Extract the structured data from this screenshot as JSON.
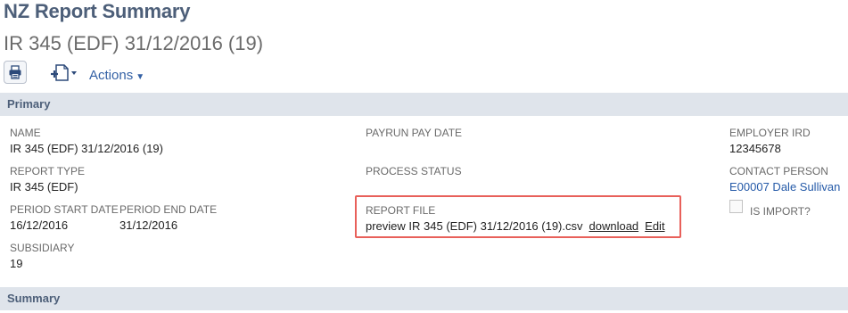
{
  "header": {
    "page_title": "NZ Report Summary",
    "record_title": "IR 345 (EDF) 31/12/2016 (19)"
  },
  "toolbar": {
    "print_icon": "printer-icon",
    "new_icon": "new-document-icon",
    "actions_label": "Actions"
  },
  "sections": {
    "primary": "Primary",
    "summary": "Summary"
  },
  "fields": {
    "name": {
      "label": "NAME",
      "value": "IR 345 (EDF) 31/12/2016 (19)"
    },
    "report_type": {
      "label": "REPORT TYPE",
      "value": "IR 345 (EDF)"
    },
    "period_start": {
      "label": "PERIOD START DATE",
      "value": "16/12/2016"
    },
    "period_end": {
      "label": "PERIOD END DATE",
      "value": "31/12/2016"
    },
    "subsidiary": {
      "label": "SUBSIDIARY",
      "value": "19"
    },
    "payrun_pay_date": {
      "label": "PAYRUN PAY DATE",
      "value": ""
    },
    "process_status": {
      "label": "PROCESS STATUS",
      "value": ""
    },
    "report_file": {
      "label": "REPORT FILE",
      "value": "preview IR 345 (EDF) 31/12/2016 (19).csv",
      "download_label": "download",
      "edit_label": "Edit"
    },
    "employer_ird": {
      "label": "EMPLOYER IRD",
      "value": "12345678"
    },
    "contact_person": {
      "label": "CONTACT PERSON",
      "value": "E00007 Dale Sullivan"
    },
    "is_import": {
      "label": "IS IMPORT?",
      "checked": false
    }
  },
  "colors": {
    "title": "#4d5f79",
    "link": "#255aa8",
    "section_bar": "#dfe4eb",
    "highlight_border": "#e8605a"
  }
}
